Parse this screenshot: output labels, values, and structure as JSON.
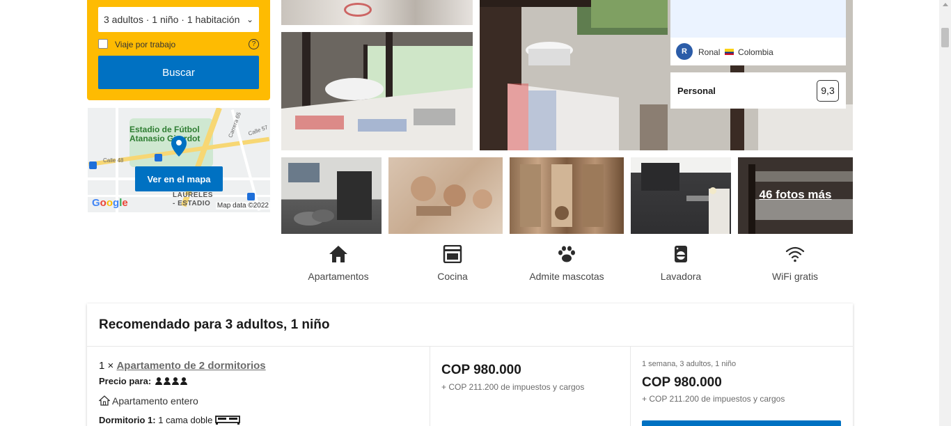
{
  "search": {
    "guests_value": "3 adultos · 1 niño · 1 habitación",
    "work_trip_label": "Viaje por trabajo",
    "help_glyph": "?",
    "search_button": "Buscar"
  },
  "map": {
    "stadium_label_line1": "Estadio de Fútbol",
    "stadium_label_line2": "Atanasio Girardot",
    "street_calle48": "Calle 48",
    "street_carrera65": "Carrera 65",
    "street_calle57": "Calle 57",
    "area_line1": "LAURELES",
    "area_line2": "- ESTADIO",
    "button": "Ver en el mapa",
    "google": "Google",
    "map_data": "Map data ©2022"
  },
  "review": {
    "avatar_letter": "R",
    "reviewer_name": "Ronal",
    "reviewer_country": "Colombia",
    "staff_label": "Personal",
    "staff_score": "9,3"
  },
  "gallery": {
    "more_photos": "46 fotos más"
  },
  "amenities": [
    {
      "label": "Apartamentos",
      "icon": "house-icon"
    },
    {
      "label": "Cocina",
      "icon": "oven-icon"
    },
    {
      "label": "Admite mascotas",
      "icon": "paw-icon"
    },
    {
      "label": "Lavadora",
      "icon": "washer-icon"
    },
    {
      "label": "WiFi gratis",
      "icon": "wifi-icon"
    }
  ],
  "recommended": {
    "title": "Recomendado para 3 adultos, 1 niño",
    "room_qty": "1 ×",
    "room_name": "Apartamento de 2 dormitorios",
    "occupancy_label": "Precio para:",
    "whole_apartment": "Apartamento entero",
    "bedroom_label": "Dormitorio 1:",
    "bedroom_value": "1 cama doble",
    "price": "COP 980.000",
    "tax_note": "+ COP 211.200 de impuestos y cargos",
    "period": "1 semana, 3 adultos, 1 niño",
    "total_price": "COP 980.000",
    "total_tax_note": "+ COP 211.200 de impuestos y cargos"
  },
  "colors": {
    "brand_blue": "#0071c2",
    "search_yellow": "#febb02"
  }
}
